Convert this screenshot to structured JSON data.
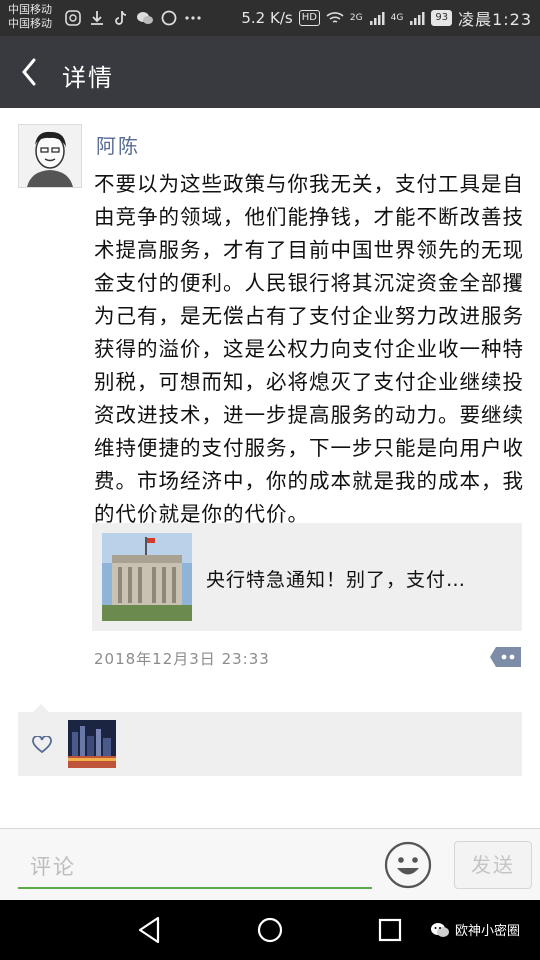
{
  "status_bar": {
    "carrier_1": "中国移动",
    "carrier_2": "中国移动",
    "speed": "5.2 K/s",
    "hd": "HD",
    "net_1": "2G",
    "net_2": "4G",
    "battery": "93",
    "time": "凌晨1:23"
  },
  "header": {
    "title": "详情"
  },
  "post": {
    "author": "阿陈",
    "text": "不要以为这些政策与你我无关，支付工具是自由竞争的领域，他们能挣钱，才能不断改善技术提高服务，才有了目前中国世界领先的无现金支付的便利。人民银行将其沉淀资金全部攫为己有，是无偿占有了支付企业努力改进服务获得的溢价，这是公权力向支付企业收一种特别税，可想而知，必将熄灭了支付企业继续投资改进技术，进一步提高服务的动力。要继续维持便捷的支付服务，下一步只能是向用户收费。市场经济中，你的成本就是我的成本，我的代价就是你的代价。",
    "link_title": "央行特急通知！别了，支付…",
    "timestamp": "2018年12月3日 23:33"
  },
  "comment_bar": {
    "placeholder": "评论",
    "send_label": "发送"
  },
  "watermark": "欧神小密圈"
}
